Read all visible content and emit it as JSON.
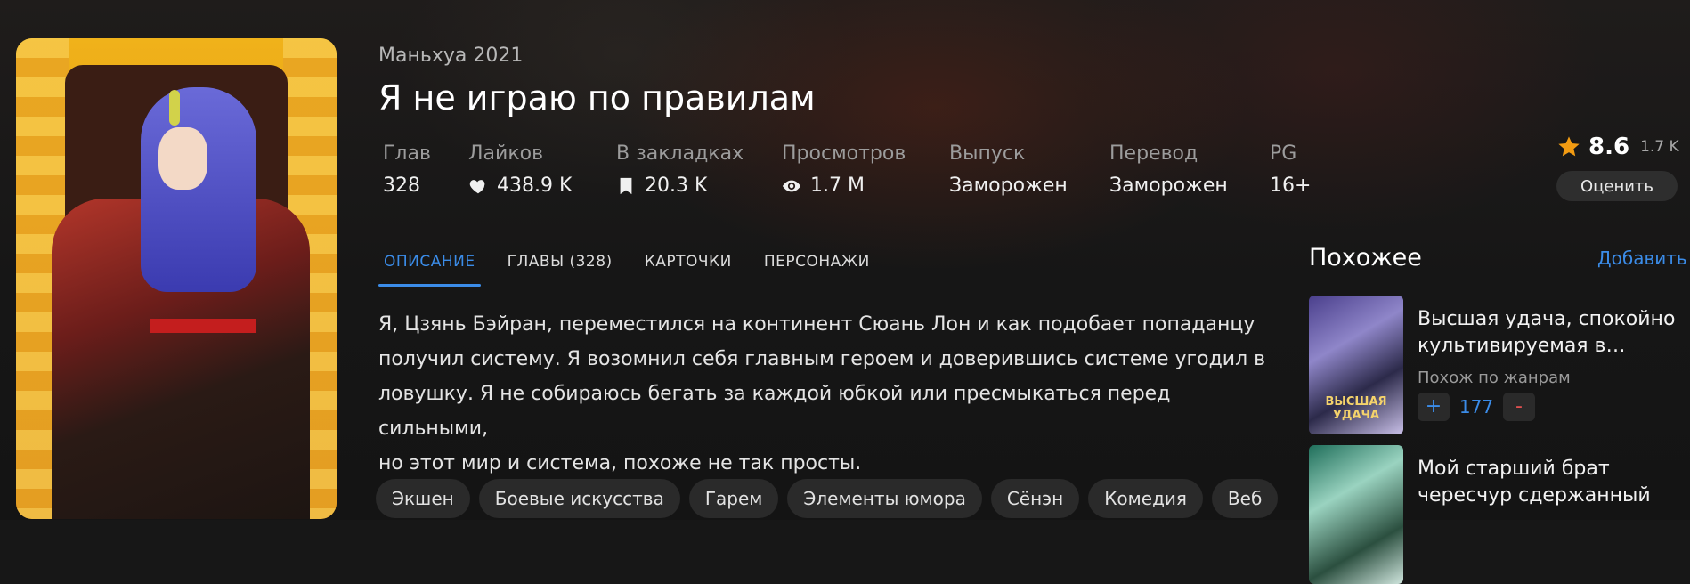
{
  "manga": {
    "type_year": "Маньхуа 2021",
    "title": "Я не играю по правилам"
  },
  "stats": [
    {
      "label": "Глав",
      "value": "328",
      "icon": ""
    },
    {
      "label": "Лайков",
      "value": "438.9 K",
      "icon": "heart-icon"
    },
    {
      "label": "В закладках",
      "value": "20.3 K",
      "icon": "bookmark-icon"
    },
    {
      "label": "Просмотров",
      "value": "1.7 M",
      "icon": "eye-icon"
    },
    {
      "label": "Выпуск",
      "value": "Заморожен",
      "icon": ""
    },
    {
      "label": "Перевод",
      "value": "Заморожен",
      "icon": ""
    },
    {
      "label": "PG",
      "value": "16+",
      "icon": ""
    }
  ],
  "rating": {
    "score": "8.6",
    "count": "1.7 K",
    "rate_button": "Оценить",
    "star_color": "#f39c12"
  },
  "tabs": [
    {
      "label": "ОПИСАНИЕ",
      "active": true
    },
    {
      "label": "ГЛАВЫ (328)",
      "active": false
    },
    {
      "label": "КАРТОЧКИ",
      "active": false
    },
    {
      "label": "ПЕРСОНАЖИ",
      "active": false
    }
  ],
  "description": {
    "lines": [
      "Я, Цзянь Бэйран, переместился на континент Сюань Лон и как подобает попаданцу",
      "получил систему. Я возомнил себя главным героем и доверившись системе угодил в",
      "ловушку. Я не собираюсь бегать за каждой юбкой или пресмыкаться перед сильными,",
      "но этот мир и система, похоже не так просты."
    ]
  },
  "tags": [
    "Экшен",
    "Боевые искусства",
    "Гарем",
    "Элементы юмора",
    "Сёнэн",
    "Комедия",
    "Веб"
  ],
  "similar": {
    "heading": "Похожее",
    "add_label": "Добавить",
    "items": [
      {
        "title": "Высшая удача, спокойно культивируемая в…",
        "reason": "Похож по жанрам",
        "votes": "177",
        "plus": "+",
        "minus": "-",
        "thumb_text": "ВЫСШАЯ УДАЧА"
      },
      {
        "title": "Мой старший брат чересчур сдержанный"
      }
    ]
  },
  "colors": {
    "accent": "#3b8ce8",
    "background": "#171717"
  }
}
